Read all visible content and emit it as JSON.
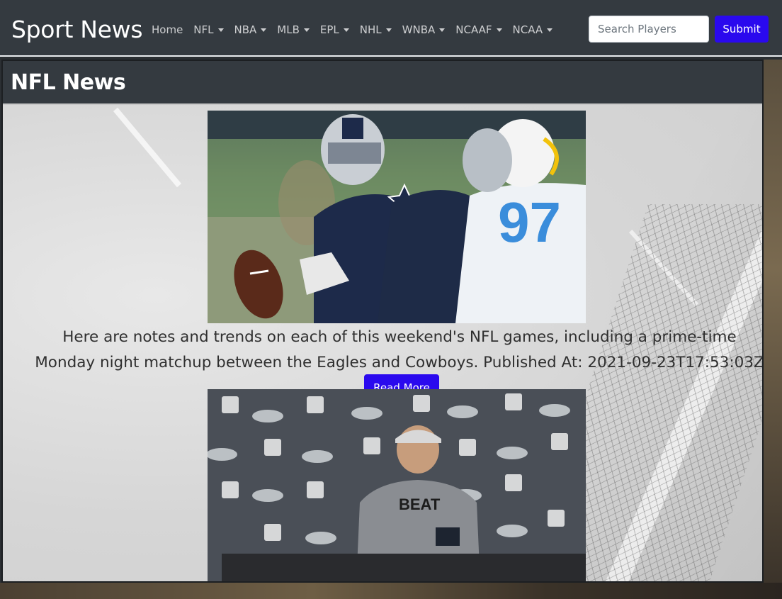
{
  "navbar": {
    "brand": "Sport News",
    "links": [
      {
        "label": "Home",
        "dropdown": false
      },
      {
        "label": "NFL",
        "dropdown": true
      },
      {
        "label": "NBA",
        "dropdown": true
      },
      {
        "label": "MLB",
        "dropdown": true
      },
      {
        "label": "EPL",
        "dropdown": true
      },
      {
        "label": "NHL",
        "dropdown": true
      },
      {
        "label": "WNBA",
        "dropdown": true
      },
      {
        "label": "NCAAF",
        "dropdown": true
      },
      {
        "label": "NCAA",
        "dropdown": true
      }
    ],
    "search_placeholder": "Search Players",
    "search_value": "",
    "submit_label": "Submit"
  },
  "card": {
    "title": "NFL News",
    "articles": [
      {
        "image_name": "football-quarterback-photo",
        "text": "Here are notes and trends on each of this weekend's NFL games, including a prime-time Monday night matchup between the Eagles and Cowboys. Published At: 2021-09-23T17:53:03Z",
        "button_label": "Read More"
      },
      {
        "image_name": "press-conference-photo"
      }
    ]
  },
  "colors": {
    "navbar_bg": "#343a40",
    "accent": "#2a09ee",
    "text": "#2f2f2f"
  }
}
